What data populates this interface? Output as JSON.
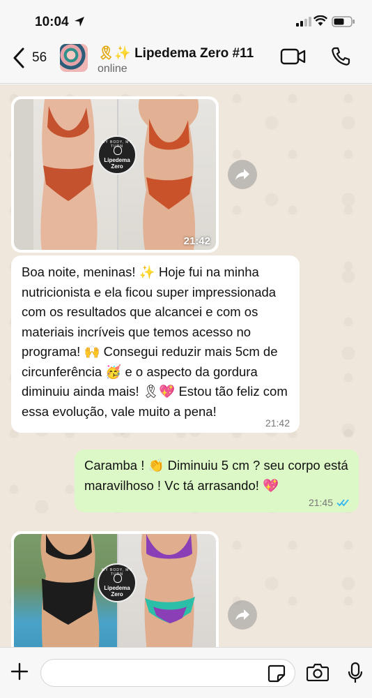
{
  "status_bar": {
    "time": "10:04"
  },
  "header": {
    "back_count": "56",
    "chat_emoji": "🎗✨",
    "chat_title": "Lipedema Zero #11",
    "chat_status": "online"
  },
  "messages": {
    "image1": {
      "time": "21:42",
      "logo_small": "MY BODY, MY TURN",
      "logo_text": "Lipedema Zero"
    },
    "text_in": {
      "text": "Boa noite, meninas! ✨  Hoje fui na minha nutricionista e ela ficou super impressionada com os resultados que alcancei e com os materiais incríveis que temos acesso no programa! 🙌 Consegui reduzir mais 5cm de circunferência 🥳 e o aspecto da gordura diminuiu ainda mais! 🎗💖 Estou tão feliz com essa evolução, vale muito a pena!",
      "time": "21:42"
    },
    "text_out": {
      "text": "Caramba ! 👏 Diminuiu 5 cm ? seu corpo está maravilhoso ! Vc tá arrasando! 💖",
      "time": "21:45"
    },
    "image2": {
      "logo_small": "MY BODY, MY TURN",
      "logo_text": "Lipedema Zero"
    }
  },
  "input": {
    "placeholder": "",
    "value": ""
  },
  "colors": {
    "chat_bg": "#efe7dc",
    "outgoing_bubble": "#dcf8c6",
    "incoming_bubble": "#ffffff",
    "read_ticks": "#34b7f1"
  },
  "icons": [
    "location-arrow-icon",
    "signal-icon",
    "wifi-icon",
    "battery-icon",
    "back-chevron-icon",
    "video-call-icon",
    "phone-icon",
    "forward-icon",
    "plus-icon",
    "sticker-icon",
    "camera-icon",
    "microphone-icon",
    "double-check-icon"
  ]
}
